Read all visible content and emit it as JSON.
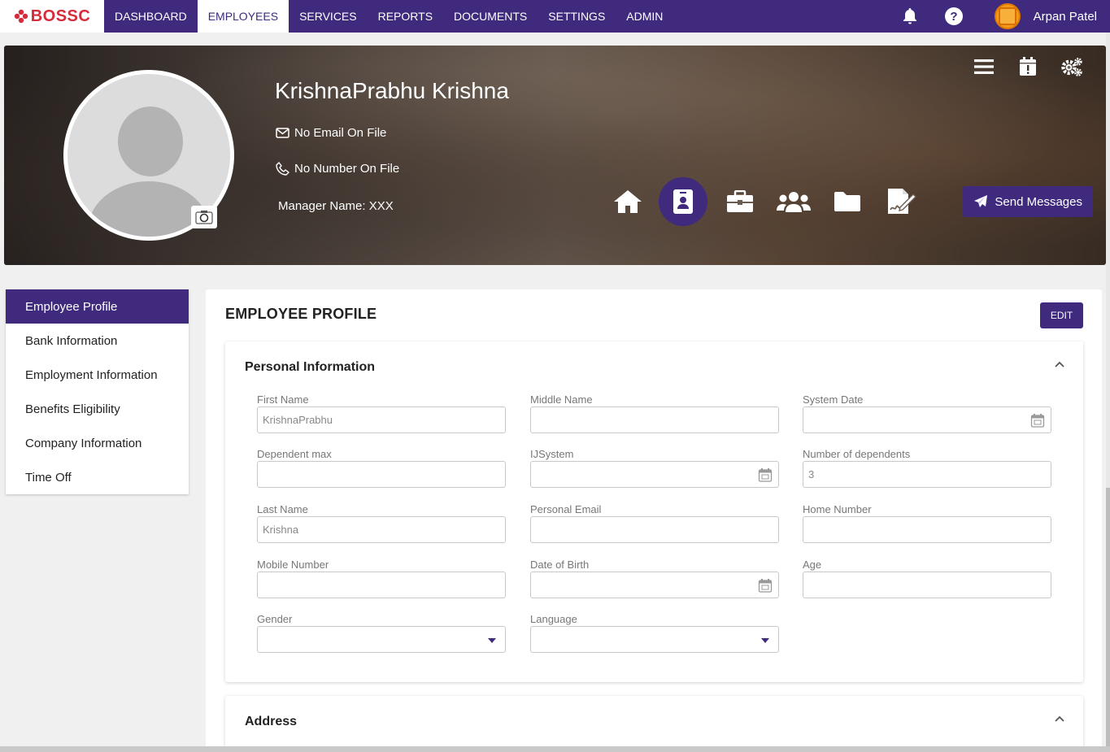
{
  "app": {
    "logo_text": "BOSSC"
  },
  "nav": {
    "items": [
      {
        "label": "DASHBOARD",
        "active": false
      },
      {
        "label": "EMPLOYEES",
        "active": true
      },
      {
        "label": "SERVICES",
        "active": false
      },
      {
        "label": "REPORTS",
        "active": false
      },
      {
        "label": "DOCUMENTS",
        "active": false
      },
      {
        "label": "SETTINGS",
        "active": false
      },
      {
        "label": "ADMIN",
        "active": false
      }
    ],
    "icons": [
      "bell-icon",
      "help-icon"
    ],
    "user_name": "Arpan Patel"
  },
  "banner": {
    "employee_name": "KrishnaPrabhu Krishna",
    "email": "No Email On File",
    "phone": "No Number On File",
    "manager": "Manager Name: XXX",
    "tools": [
      "menu-icon",
      "calendar-alert-icon",
      "settings-icon"
    ],
    "quick_icons": [
      "home-icon",
      "id-badge-icon",
      "briefcase-icon",
      "users-icon",
      "folder-icon",
      "signature-icon"
    ],
    "active_quick_icon": "id-badge-icon",
    "send_label": "Send Messages"
  },
  "sidebar": {
    "items": [
      {
        "label": "Employee Profile",
        "active": true
      },
      {
        "label": "Bank Information",
        "active": false
      },
      {
        "label": "Employment Information",
        "active": false
      },
      {
        "label": "Benefits Eligibility",
        "active": false
      },
      {
        "label": "Company Information",
        "active": false
      },
      {
        "label": "Time Off",
        "active": false
      }
    ]
  },
  "main": {
    "title": "EMPLOYEE PROFILE",
    "edit_label": "EDIT",
    "personal": {
      "title": "Personal Information",
      "fields": {
        "first_name": {
          "label": "First Name",
          "value": "KrishnaPrabhu"
        },
        "middle_name": {
          "label": "Middle Name",
          "value": ""
        },
        "system_date": {
          "label": "System Date",
          "value": ""
        },
        "dependent_max": {
          "label": "Dependent max",
          "value": ""
        },
        "ijsystem": {
          "label": "IJSystem",
          "value": ""
        },
        "num_dependents": {
          "label": "Number of dependents",
          "value": "3"
        },
        "last_name": {
          "label": "Last Name",
          "value": "Krishna"
        },
        "personal_email": {
          "label": "Personal Email",
          "value": ""
        },
        "home_number": {
          "label": "Home Number",
          "value": ""
        },
        "mobile_number": {
          "label": "Mobile Number",
          "value": ""
        },
        "dob": {
          "label": "Date of Birth",
          "value": ""
        },
        "age": {
          "label": "Age",
          "value": ""
        },
        "gender": {
          "label": "Gender",
          "value": ""
        },
        "language": {
          "label": "Language",
          "value": ""
        }
      }
    },
    "address": {
      "title": "Address"
    }
  },
  "colors": {
    "primary": "#3f2a7e",
    "logo_red": "#d52b3a"
  }
}
